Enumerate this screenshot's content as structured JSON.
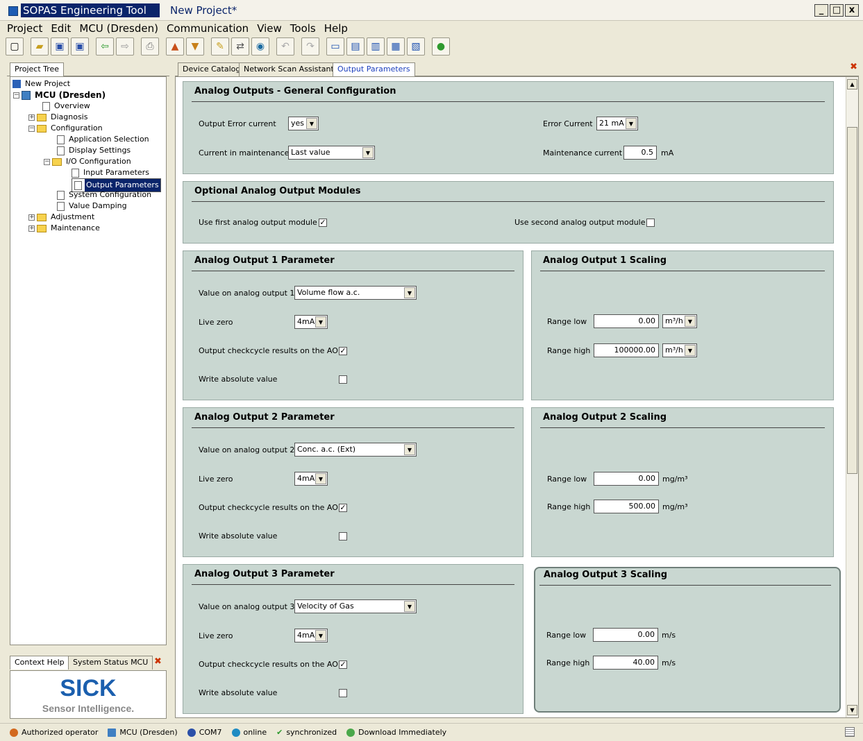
{
  "window": {
    "app_title": "SOPAS Engineering Tool",
    "project_title": "New Project*",
    "min": "_",
    "max": "□",
    "close": "x"
  },
  "menu": [
    "Project",
    "Edit",
    "MCU (Dresden)",
    "Communication",
    "View",
    "Tools",
    "Help"
  ],
  "left": {
    "tab_project_tree": "Project Tree",
    "tree": {
      "root": "New Project",
      "device": "MCU (Dresden)",
      "overview": "Overview",
      "diagnosis": "Diagnosis",
      "configuration": "Configuration",
      "application_selection": "Application Selection",
      "display_settings": "Display Settings",
      "io_configuration": "I/O Configuration",
      "input_parameters": "Input Parameters",
      "output_parameters": "Output Parameters",
      "system_configuration": "System Configuration",
      "value_damping": "Value Damping",
      "adjustment": "Adjustment",
      "maintenance": "Maintenance"
    },
    "tab_context_help": "Context Help",
    "tab_system_status": "System Status MCU",
    "logo_text": "SICK",
    "logo_tagline": "Sensor Intelligence."
  },
  "tabs": {
    "device_catalog": "Device Catalog",
    "network_scan": "Network Scan Assistant",
    "output_parameters": "Output Parameters"
  },
  "general": {
    "title": "Analog Outputs - General Configuration",
    "output_error_current_label": "Output Error current",
    "output_error_current_value": "yes",
    "error_current_label": "Error Current",
    "error_current_value": "21 mA",
    "current_in_maintenance_label": "Current in maintenance",
    "current_in_maintenance_value": "Last value",
    "maintenance_current_label": "Maintenance current",
    "maintenance_current_value": "0.5",
    "maintenance_current_unit": "mA"
  },
  "modules": {
    "title": "Optional Analog Output Modules",
    "use_first_label": "Use first analog output module",
    "use_first_checked": "✓",
    "use_second_label": "Use second analog output module",
    "use_second_checked": ""
  },
  "ao1": {
    "param_title": "Analog Output 1 Parameter",
    "value_label": "Value on analog output 1",
    "value": "Volume flow a.c.",
    "live_zero_label": "Live zero",
    "live_zero": "4mA",
    "checkcycle_label": "Output checkcycle results on the AO",
    "checkcycle": "✓",
    "abs_label": "Write absolute value",
    "abs": "",
    "scaling_title": "Analog Output 1 Scaling",
    "range_low_label": "Range low",
    "range_low": "0.00",
    "range_low_unit": "m³/h",
    "range_high_label": "Range high",
    "range_high": "100000.00",
    "range_high_unit": "m³/h"
  },
  "ao2": {
    "param_title": "Analog Output 2 Parameter",
    "value_label": "Value on analog output 2",
    "value": "Conc. a.c. (Ext)",
    "live_zero_label": "Live zero",
    "live_zero": "4mA",
    "checkcycle_label": "Output checkcycle results on the AO",
    "checkcycle": "✓",
    "abs_label": "Write absolute value",
    "abs": "",
    "scaling_title": "Analog Output 2 Scaling",
    "range_low_label": "Range low",
    "range_low": "0.00",
    "range_low_unit": "mg/m³",
    "range_high_label": "Range high",
    "range_high": "500.00",
    "range_high_unit": "mg/m³"
  },
  "ao3": {
    "param_title": "Analog Output 3 Parameter",
    "value_label": "Value on analog output 3",
    "value": "Velocity of Gas",
    "live_zero_label": "Live zero",
    "live_zero": "4mA",
    "checkcycle_label": "Output checkcycle results on the AO",
    "checkcycle": "✓",
    "abs_label": "Write absolute value",
    "abs": "",
    "scaling_title": "Analog Output 3 Scaling",
    "range_low_label": "Range low",
    "range_low": "0.00",
    "range_low_unit": "m/s",
    "range_high_label": "Range high",
    "range_high": "40.00",
    "range_high_unit": "m/s"
  },
  "status": {
    "user": "Authorized operator",
    "device": "MCU (Dresden)",
    "port": "COM7",
    "online": "online",
    "sync": "synchronized",
    "download": "Download Immediately"
  },
  "colors": {
    "panel_bg": "#c9d7d1",
    "selection": "#0a246a",
    "accent_tab": "#1c3fbd",
    "logo_blue": "#1b5fae"
  },
  "icons": [
    "new-icon",
    "open-folder-icon",
    "save-icon",
    "save-all-icon",
    "back-icon",
    "forward-icon",
    "print-icon",
    "device-upload-icon",
    "device-download-icon",
    "edit-icon",
    "connect-icon",
    "scan-icon",
    "undo-icon",
    "redo-icon",
    "layout-1-icon",
    "layout-2-icon",
    "layout-3-icon",
    "layout-4-icon",
    "layout-5-icon",
    "help-icon"
  ]
}
